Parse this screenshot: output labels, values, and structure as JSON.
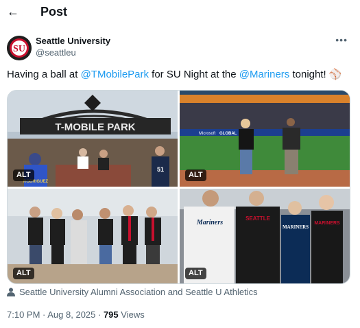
{
  "header": {
    "back_icon": "arrow-left-icon",
    "title": "Post"
  },
  "author": {
    "name": "Seattle University",
    "handle": "@seattleu",
    "avatar_icon": "su-logo",
    "more_icon": "more-horizontal-icon"
  },
  "post": {
    "text_1": "Having a ball at ",
    "mention_1": "@TMobilePark",
    "text_2": " for SU Night at the ",
    "mention_2": "@Mariners",
    "text_3": " tonight! ",
    "emoji": "⚾"
  },
  "media": {
    "photos": [
      {
        "alt": "ALT",
        "sign": "T-MOBILE PARK",
        "jersey": "RODRIGUEZ"
      },
      {
        "alt": "ALT",
        "board": "GLOBAL",
        "board2": "Microsoft"
      },
      {
        "alt": "ALT"
      },
      {
        "alt": "ALT",
        "jersey_a": "Mariners",
        "jersey_b": "SEATTLE",
        "jersey_c": "MARINERS"
      }
    ]
  },
  "tagged": "Seattle University Alumni Association and Seattle U Athletics",
  "meta": {
    "time": "7:10 PM",
    "dot": " · ",
    "date": "Aug 8, 2025",
    "views_count": "795",
    "views_label": " Views"
  },
  "colors": {
    "link": "#1d9bf0",
    "secondary": "#536471",
    "primary": "#0f1419"
  }
}
